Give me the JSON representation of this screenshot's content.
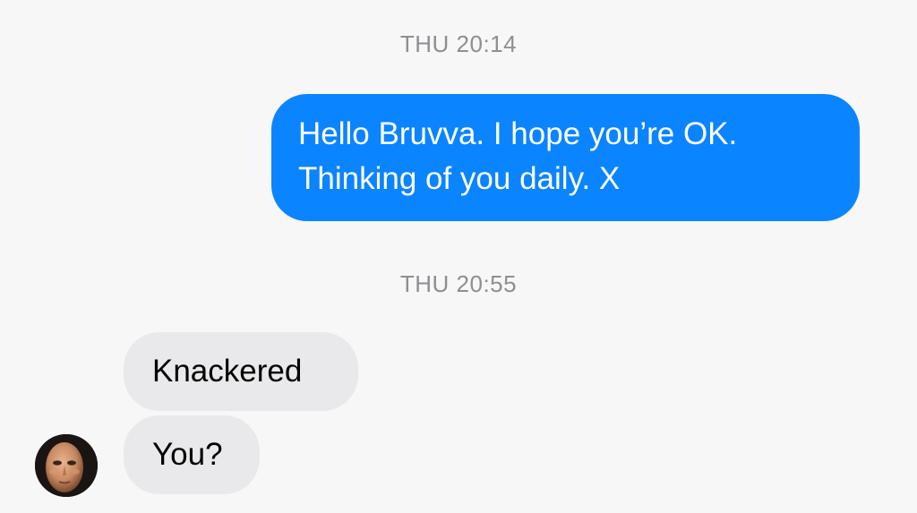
{
  "conversation": {
    "timestamp_1": "THU 20:14",
    "sent_message": {
      "line_1": "Hello Bruvva. I hope you’re OK.",
      "line_2": "Thinking of you daily. X"
    },
    "timestamp_2": "THU 20:55",
    "received_messages": [
      {
        "text": "Knackered"
      },
      {
        "text": "You?"
      }
    ],
    "avatar_icon": "mask-face-avatar"
  },
  "colors": {
    "background": "#f7f7f7",
    "sent_bubble": "#0b84ff",
    "received_bubble": "#e9e9eb",
    "timestamp_text": "#8e8e93"
  }
}
